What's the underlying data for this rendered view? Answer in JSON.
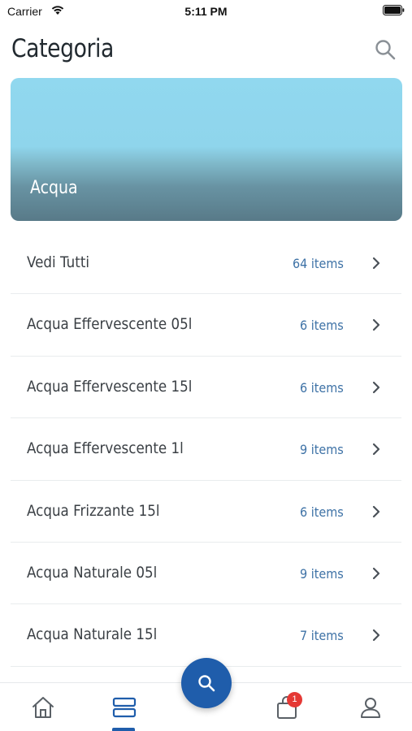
{
  "status_bar": {
    "carrier": "Carrier",
    "time": "5:11 PM",
    "wifi_icon": "wifi-icon",
    "battery_icon": "battery-icon"
  },
  "header": {
    "title": "Categoria",
    "search_icon": "search-icon"
  },
  "banner": {
    "title": "Acqua",
    "gradient_top": "#91d8ef",
    "gradient_bottom": "#587a88"
  },
  "list": {
    "items": [
      {
        "label": "Vedi Tutti",
        "count": "64 items"
      },
      {
        "label": "Acqua Effervescente 05l",
        "count": "6 items"
      },
      {
        "label": "Acqua Effervescente 15l",
        "count": "6 items"
      },
      {
        "label": "Acqua Effervescente 1l",
        "count": "9 items"
      },
      {
        "label": "Acqua Frizzante 15l",
        "count": "6 items"
      },
      {
        "label": "Acqua Naturale 05l",
        "count": "9 items"
      },
      {
        "label": "Acqua Naturale 15l",
        "count": "7 items"
      }
    ],
    "count_color": "#3e72a6"
  },
  "tab_bar": {
    "tabs": [
      {
        "name": "home",
        "icon": "home-icon"
      },
      {
        "name": "categories",
        "icon": "categories-icon",
        "active": true
      },
      {
        "name": "cart",
        "icon": "shopping-bag-icon"
      },
      {
        "name": "profile",
        "icon": "user-icon"
      }
    ],
    "cart_badge": "1",
    "accent_color": "#1f5dab",
    "badge_color": "#e53935"
  },
  "fab": {
    "icon": "search-icon"
  }
}
